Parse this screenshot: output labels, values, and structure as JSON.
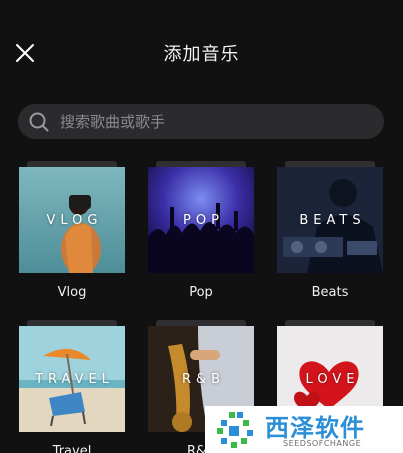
{
  "header": {
    "title": "添加音乐"
  },
  "search": {
    "placeholder": "搜索歌曲或歌手"
  },
  "categories": [
    {
      "overlay": "VLOG",
      "label": "Vlog"
    },
    {
      "overlay": "POP",
      "label": "Pop"
    },
    {
      "overlay": "BEATS",
      "label": "Beats"
    },
    {
      "overlay": "TRAVEL",
      "label": "Travel"
    },
    {
      "overlay": "R&B",
      "label": "R&B"
    },
    {
      "overlay": "LOVE",
      "label": ""
    }
  ],
  "watermark": {
    "text": "西泽软件",
    "sub": "SEEDSOFCHANGE"
  },
  "colors": {
    "background": "#111112",
    "search_bg": "#2b2b2d",
    "watermark_blue": "#2a8fd6",
    "watermark_green": "#3fb84a"
  },
  "icons": {
    "close": "close-icon",
    "search": "search-icon"
  }
}
